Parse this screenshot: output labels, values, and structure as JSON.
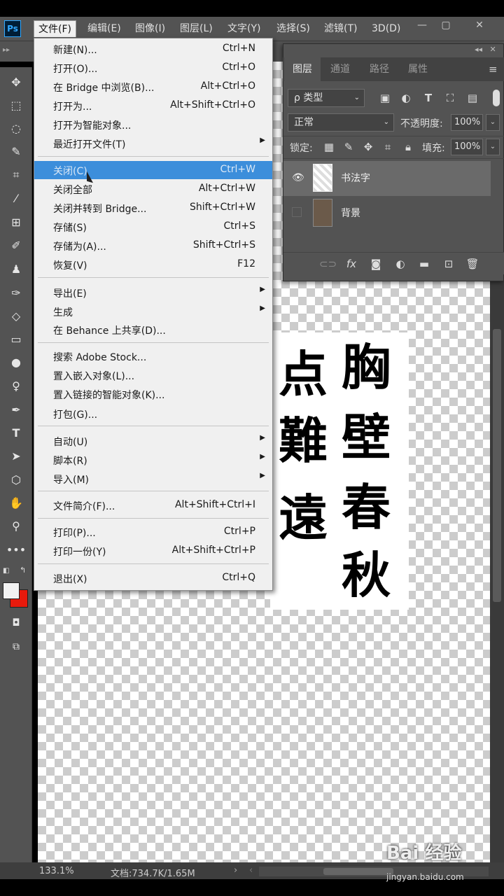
{
  "app": {
    "logo": "Ps"
  },
  "menubar": {
    "items": [
      "文件(F)",
      "编辑(E)",
      "图像(I)",
      "图层(L)",
      "文字(Y)",
      "选择(S)",
      "滤镜(T)",
      "3D(D)"
    ],
    "window_controls": [
      "—",
      "▢",
      "✕"
    ]
  },
  "file_menu": {
    "items": [
      {
        "label": "新建(N)...",
        "shortcut": "Ctrl+N"
      },
      {
        "label": "打开(O)...",
        "shortcut": "Ctrl+O"
      },
      {
        "label": "在 Bridge 中浏览(B)...",
        "shortcut": "Alt+Ctrl+O"
      },
      {
        "label": "打开为...",
        "shortcut": "Alt+Shift+Ctrl+O"
      },
      {
        "label": "打开为智能对象...",
        "shortcut": ""
      },
      {
        "label": "最近打开文件(T)",
        "shortcut": "",
        "submenu": true
      },
      {
        "label": "关闭(C)",
        "shortcut": "Ctrl+W",
        "highlighted": true
      },
      {
        "label": "关闭全部",
        "shortcut": "Alt+Ctrl+W"
      },
      {
        "label": "关闭并转到 Bridge...",
        "shortcut": "Shift+Ctrl+W"
      },
      {
        "label": "存储(S)",
        "shortcut": "Ctrl+S"
      },
      {
        "label": "存储为(A)...",
        "shortcut": "Shift+Ctrl+S"
      },
      {
        "label": "恢复(V)",
        "shortcut": "F12"
      },
      {
        "label": "导出(E)",
        "shortcut": "",
        "submenu": true
      },
      {
        "label": "生成",
        "shortcut": "",
        "submenu": true
      },
      {
        "label": "在 Behance 上共享(D)...",
        "shortcut": ""
      },
      {
        "label": "搜索 Adobe Stock...",
        "shortcut": ""
      },
      {
        "label": "置入嵌入对象(L)...",
        "shortcut": ""
      },
      {
        "label": "置入链接的智能对象(K)...",
        "shortcut": ""
      },
      {
        "label": "打包(G)...",
        "shortcut": ""
      },
      {
        "label": "自动(U)",
        "shortcut": "",
        "submenu": true
      },
      {
        "label": "脚本(R)",
        "shortcut": "",
        "submenu": true
      },
      {
        "label": "导入(M)",
        "shortcut": "",
        "submenu": true
      },
      {
        "label": "文件简介(F)...",
        "shortcut": "Alt+Shift+Ctrl+I"
      },
      {
        "label": "打印(P)...",
        "shortcut": "Ctrl+P"
      },
      {
        "label": "打印一份(Y)",
        "shortcut": "Alt+Shift+Ctrl+P"
      },
      {
        "label": "退出(X)",
        "shortcut": "Ctrl+Q"
      }
    ]
  },
  "layers_panel": {
    "tabs": [
      "图层",
      "通道",
      "路径",
      "属性"
    ],
    "filter_kind": "ρ 类型",
    "blend_mode": "正常",
    "opacity_label": "不透明度:",
    "opacity_value": "100%",
    "lock_label": "锁定:",
    "fill_label": "填充:",
    "fill_value": "100%",
    "layers": [
      {
        "name": "书法字",
        "visible": true,
        "selected": true
      },
      {
        "name": "背景",
        "visible": false,
        "selected": false
      }
    ],
    "footer_icons": [
      "link-icon",
      "fx-icon",
      "mask-icon",
      "adjustment-icon",
      "group-icon",
      "new-layer-icon",
      "trash-icon"
    ]
  },
  "artwork": {
    "chars_left": [
      "点",
      "難",
      "遠"
    ],
    "chars_right": [
      "胸",
      "壁",
      "春",
      "秋"
    ]
  },
  "status": {
    "zoom": "133.1%",
    "doc": "文档:734.7K/1.65M"
  },
  "watermark": {
    "brand": "Bai 经验",
    "url": "jingyan.baidu.com"
  },
  "colors": {
    "foreground": "#f2f2f2",
    "background": "#e81a0c",
    "highlight": "#3c8edb"
  }
}
